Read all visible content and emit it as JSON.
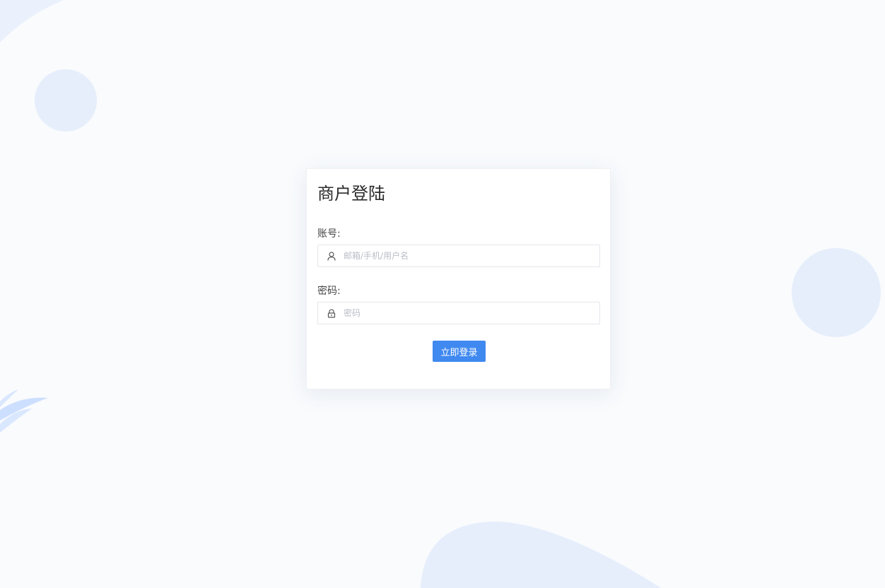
{
  "login": {
    "title": "商户登陆",
    "account_label": "账号:",
    "account_placeholder": "邮箱/手机/用户名",
    "account_icon": "user-icon",
    "password_label": "密码:",
    "password_placeholder": "密码",
    "password_icon": "lock-icon",
    "submit_label": "立即登录"
  },
  "theme": {
    "background": "#f9fbfd",
    "decoration": "#e6efff",
    "leaf": "#c9dcff",
    "primary": "#4089f0"
  }
}
